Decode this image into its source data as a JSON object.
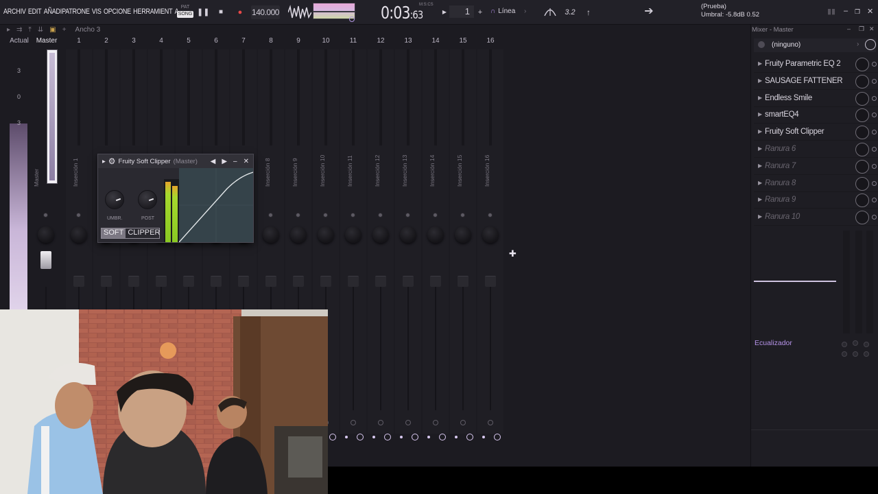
{
  "topbar": {
    "menu": [
      "ARCHIV",
      "EDIT",
      "AÑADI",
      "PATRONE",
      "VIS",
      "OPCIONE",
      "HERRAMIENT",
      "A"
    ],
    "pat_label": "PAT",
    "song_label": "SONG",
    "tempo": "140.000",
    "time_main": "0:03",
    "time_sub": ":63",
    "time_unit": "M:S:CS",
    "pattern_number": "1",
    "snap_label": "Línea",
    "snap_icon": "magnet-icon",
    "step_label": "3.2",
    "hint_title": "(Prueba)",
    "hint_value": "Umbral: -5.8dB  0.52"
  },
  "mixer": {
    "toolbar_width_label": "Ancho 3",
    "col_current": "Actual",
    "col_master": "Master",
    "track_numbers": [
      "1",
      "2",
      "3",
      "4",
      "5",
      "6",
      "7",
      "8",
      "9",
      "10",
      "11",
      "12",
      "13",
      "14",
      "15",
      "16"
    ],
    "master_strip_name": "Master",
    "insert_names": [
      "Inserción 1",
      "Inserción 2",
      "Inserción 3",
      "Inserción 4",
      "Inserción 5",
      "Inserción 6",
      "Inserción 7",
      "Inserción 8",
      "Inserción 9",
      "Inserción 10",
      "Inserción 11",
      "Inserción 12",
      "Inserción 13",
      "Inserción 14",
      "Inserción 15",
      "Inserción 16"
    ],
    "left_scale": [
      "3",
      "0",
      "3"
    ]
  },
  "plugin": {
    "title": "Fruity Soft Clipper",
    "subtitle": "(Master)",
    "knob1_label": "UMBR.",
    "knob2_label": "POST",
    "logo_left": "SOFT",
    "logo_right": "CLIPPER"
  },
  "right_panel": {
    "title": "Mixer - Master",
    "input_value": "(ninguno)",
    "slots": [
      {
        "name": "Fruity Parametric EQ 2",
        "empty": false
      },
      {
        "name": "SAUSAGE FATTENER",
        "empty": false
      },
      {
        "name": "Endless Smile",
        "empty": false
      },
      {
        "name": "smartEQ4",
        "empty": false
      },
      {
        "name": "Fruity Soft Clipper",
        "empty": false
      },
      {
        "name": "Ranura 6",
        "empty": true
      },
      {
        "name": "Ranura 7",
        "empty": true
      },
      {
        "name": "Ranura 8",
        "empty": true
      },
      {
        "name": "Ranura 9",
        "empty": true
      },
      {
        "name": "Ranura 10",
        "empty": true
      }
    ],
    "eq_label": "Ecualizador"
  },
  "colors": {
    "accent": "#b28ee8",
    "background": "#1c1b21",
    "meter_green": "#89c823"
  }
}
